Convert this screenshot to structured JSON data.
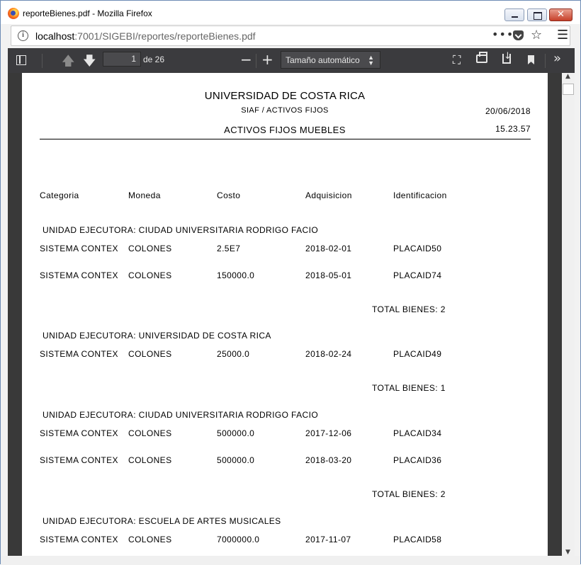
{
  "window": {
    "title": "reporteBienes.pdf - Mozilla Firefox",
    "close_glyph": "✕"
  },
  "urlbar": {
    "host": "localhost",
    "path": ":7001/SIGEBI/reportes/reporteBienes.pdf",
    "dots": "•••",
    "star": "☆",
    "menu": "☰"
  },
  "pdf_toolbar": {
    "current_page": "1",
    "page_of": "de 26",
    "zoom_label": "Tamaño automático",
    "zoom_out": "−",
    "zoom_in": "+",
    "up_glyph": "🡅",
    "down_glyph": "🡇",
    "present_glyph": "⛶",
    "more_glyph": "»"
  },
  "report": {
    "title": "UNIVERSIDAD DE COSTA RICA",
    "subtitle": "SIAF / ACTIVOS FIJOS",
    "date": "20/06/2018",
    "heading": "ACTIVOS FIJOS MUEBLES",
    "time": "15.23.57",
    "columns": [
      "Categoria",
      "Moneda",
      "Costo",
      "Adquisicion",
      "Identificacion"
    ],
    "groups": [
      {
        "unit": "UNIDAD EJECUTORA: CIUDAD UNIVERSITARIA RODRIGO FACIO",
        "rows": [
          [
            "SISTEMA CONTEX",
            "COLONES",
            "2.5E7",
            "2018-02-01",
            "PLACAID50"
          ],
          [
            "SISTEMA CONTEX",
            "COLONES",
            "150000.0",
            "2018-05-01",
            "PLACAID74"
          ]
        ],
        "total": "TOTAL BIENES: 2"
      },
      {
        "unit": "UNIDAD EJECUTORA: UNIVERSIDAD DE COSTA RICA",
        "rows": [
          [
            "SISTEMA CONTEX",
            "COLONES",
            "25000.0",
            "2018-02-24",
            "PLACAID49"
          ]
        ],
        "total": "TOTAL BIENES: 1"
      },
      {
        "unit": "UNIDAD EJECUTORA: CIUDAD UNIVERSITARIA RODRIGO FACIO",
        "rows": [
          [
            "SISTEMA CONTEX",
            "COLONES",
            "500000.0",
            "2017-12-06",
            "PLACAID34"
          ],
          [
            "SISTEMA CONTEX",
            "COLONES",
            "500000.0",
            "2018-03-20",
            "PLACAID36"
          ]
        ],
        "total": "TOTAL BIENES: 2"
      },
      {
        "unit": "UNIDAD EJECUTORA: ESCUELA DE ARTES MUSICALES",
        "rows": [
          [
            "SISTEMA CONTEX",
            "COLONES",
            "7000000.0",
            "2017-11-07",
            "PLACAID58"
          ]
        ]
      }
    ]
  }
}
